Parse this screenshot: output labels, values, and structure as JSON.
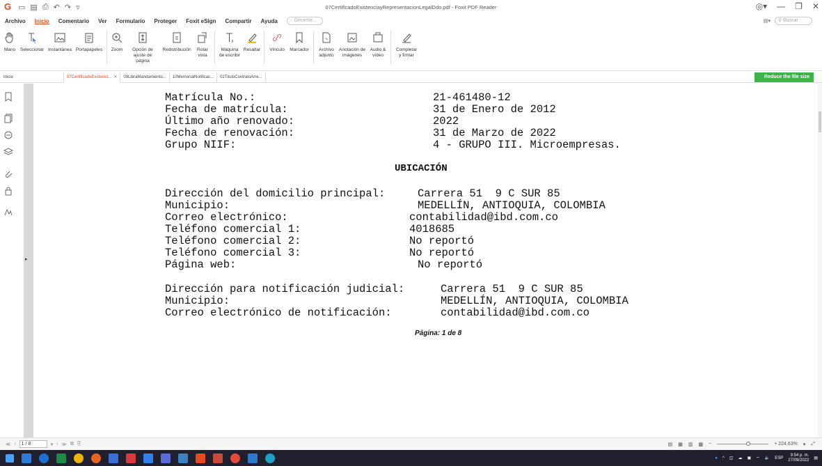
{
  "titlebar": {
    "window_title": "07CertificadoExistenciayRepresentacionLegalDdo.pdf - Foxit PDF Reader"
  },
  "menu": {
    "items": [
      "Archivo",
      "Inicio",
      "Comentario",
      "Ver",
      "Formulario",
      "Proteger",
      "Foxit eSign",
      "Compartir",
      "Ayuda"
    ],
    "tell_me_placeholder": "Decirme...",
    "search_placeholder": "Buscar"
  },
  "ribbon": {
    "buttons": [
      {
        "label": "Mano",
        "icon": "hand-icon"
      },
      {
        "label": "Seleccionar",
        "icon": "select-text-icon"
      },
      {
        "label": "Instantánea",
        "icon": "snapshot-icon"
      },
      {
        "label": "Portapapeles",
        "icon": "clipboard-icon"
      },
      {
        "label": "Zoom",
        "icon": "zoom-icon"
      },
      {
        "label": "Opción de ajuste de página",
        "icon": "fit-page-icon"
      },
      {
        "label": "Redistribución",
        "icon": "reflow-icon"
      },
      {
        "label": "Rotar vista",
        "icon": "rotate-icon"
      },
      {
        "label": "Máquina de escribir",
        "icon": "typewriter-icon"
      },
      {
        "label": "Resaltar",
        "icon": "highlight-icon"
      },
      {
        "label": "Vínculo",
        "icon": "link-icon"
      },
      {
        "label": "Marcador",
        "icon": "bookmark-icon"
      },
      {
        "label": "Archivo adjunto",
        "icon": "attachment-icon"
      },
      {
        "label": "Anotación de imágenes",
        "icon": "image-annotation-icon"
      },
      {
        "label": "Audio & vídeo",
        "icon": "audio-video-icon"
      },
      {
        "label": "Completar y firmar",
        "icon": "fill-sign-icon"
      }
    ]
  },
  "tabs": {
    "home": "Inicio",
    "docs": [
      "07CertificadoExistenci...",
      "09LibraMandamiento...",
      "10MemorialNotificac...",
      "02TituloContratoArre..."
    ],
    "reduce_label": "Reduce the file size"
  },
  "document": {
    "info_rows": [
      {
        "label": "Matrícula No.:",
        "value": "21-461480-12"
      },
      {
        "label": "Fecha de matrícula:",
        "value": "31 de Enero de 2012"
      },
      {
        "label": "Último año renovado:",
        "value": "2022"
      },
      {
        "label": "Fecha de renovación:",
        "value": "31 de Marzo de 2022"
      },
      {
        "label": "Grupo NIIF:",
        "value": "4 - GRUPO III. Microempresas."
      }
    ],
    "section_title": "UBICACIÓN",
    "ubicacion_rows": [
      {
        "label": "Dirección del domicilio principal:",
        "value": "Carrera 51  9 C SUR 85"
      },
      {
        "label": "Municipio:",
        "value": "MEDELLÍN, ANTIOQUIA, COLOMBIA"
      },
      {
        "label": "Correo electrónico:",
        "value": "contabilidad@ibd.com.co"
      },
      {
        "label": "Teléfono comercial 1:",
        "value": "4018685"
      },
      {
        "label": "Teléfono comercial 2:",
        "value": "No reportó"
      },
      {
        "label": "Teléfono comercial 3:",
        "value": "No reportó"
      },
      {
        "label": "Página web:",
        "value": "No reportó"
      }
    ],
    "notif_rows": [
      {
        "label": "Dirección para notificación judicial:",
        "value": "Carrera 51  9 C SUR 85"
      },
      {
        "label": "Municipio:",
        "value": "MEDELLÍN, ANTIOQUIA, COLOMBIA"
      },
      {
        "label": "Correo electrónico de notificación:",
        "value": "contabilidad@ibd.com.co"
      }
    ],
    "page_footer": "Página:  1 de  8"
  },
  "status": {
    "page_indicator": "1 / 8",
    "zoom": "+ 224,63%"
  },
  "taskbar": {
    "lang": "ESP",
    "time": "9:54 p. m.",
    "date": "27/09/2022"
  },
  "colors": {
    "accent": "#e8491d",
    "reduce_button": "#3bb54a",
    "taskbar": "#1f1f2e"
  }
}
